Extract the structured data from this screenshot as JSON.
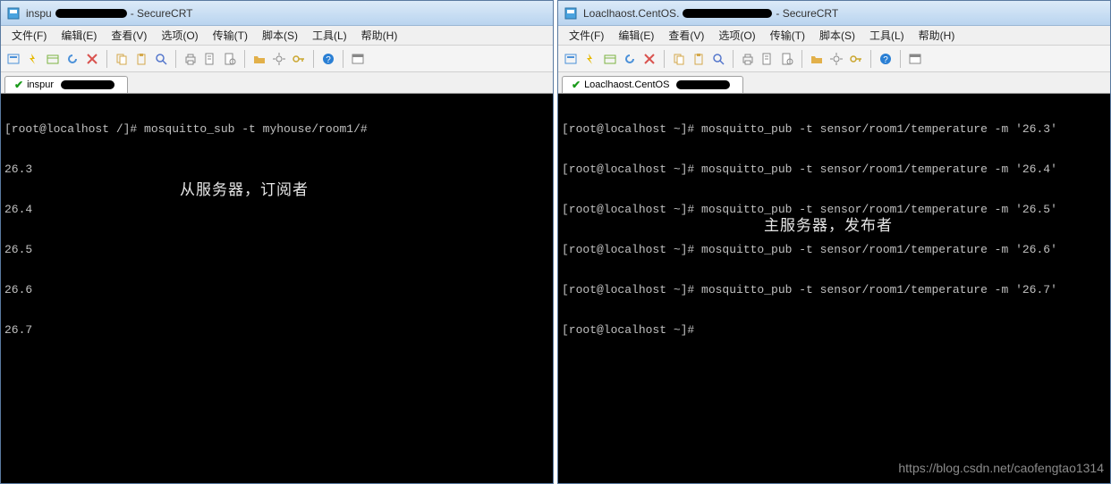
{
  "left": {
    "title_prefix": "inspu",
    "title_suffix": " - SecureCRT",
    "menu": [
      "文件(F)",
      "编辑(E)",
      "查看(V)",
      "选项(O)",
      "传输(T)",
      "脚本(S)",
      "工具(L)",
      "帮助(H)"
    ],
    "tab": "inspur",
    "terminal_lines": [
      "[root@localhost /]# mosquitto_sub -t myhouse/room1/#",
      "26.3",
      "26.4",
      "26.5",
      "26.6",
      "26.7"
    ],
    "annotation": "从服务器，订阅者"
  },
  "right": {
    "title_prefix": "Loaclhaost.CentOS.",
    "title_suffix": " - SecureCRT",
    "menu": [
      "文件(F)",
      "编辑(E)",
      "查看(V)",
      "选项(O)",
      "传输(T)",
      "脚本(S)",
      "工具(L)",
      "帮助(H)"
    ],
    "tab": "Loaclhaost.CentOS",
    "terminal_lines": [
      "[root@localhost ~]# mosquitto_pub -t sensor/room1/temperature -m '26.3'",
      "[root@localhost ~]# mosquitto_pub -t sensor/room1/temperature -m '26.4'",
      "[root@localhost ~]# mosquitto_pub -t sensor/room1/temperature -m '26.5'",
      "[root@localhost ~]# mosquitto_pub -t sensor/room1/temperature -m '26.6'",
      "[root@localhost ~]# mosquitto_pub -t sensor/room1/temperature -m '26.7'",
      "[root@localhost ~]#"
    ],
    "annotation": "主服务器，发布者"
  },
  "watermark": "https://blog.csdn.net/caofengtao1314",
  "icons": {
    "app": "app-icon",
    "check": "✔"
  },
  "toolbar_icons": [
    "new-session-icon",
    "quick-connect-icon",
    "session-mgr-icon",
    "reconnect-icon",
    "disconnect-icon",
    "|",
    "copy-icon",
    "paste-icon",
    "find-icon",
    "|",
    "print-icon",
    "page-setup-icon",
    "properties-icon",
    "|",
    "open-folder-icon",
    "settings-icon",
    "key-icon",
    "|",
    "help-icon",
    "|",
    "dialog-icon"
  ],
  "toolbar_colors": {
    "new-session-icon": "#4a90d9",
    "quick-connect-icon": "#e6b800",
    "session-mgr-icon": "#7cb342",
    "reconnect-icon": "#4a90d9",
    "disconnect-icon": "#d9534f",
    "copy-icon": "#d4a84b",
    "paste-icon": "#d4a84b",
    "find-icon": "#5577cc",
    "print-icon": "#888",
    "page-setup-icon": "#888",
    "properties-icon": "#888",
    "open-folder-icon": "#e2b04a",
    "settings-icon": "#888",
    "key-icon": "#caa62e",
    "help-icon": "#2a7fd4",
    "dialog-icon": "#888"
  }
}
